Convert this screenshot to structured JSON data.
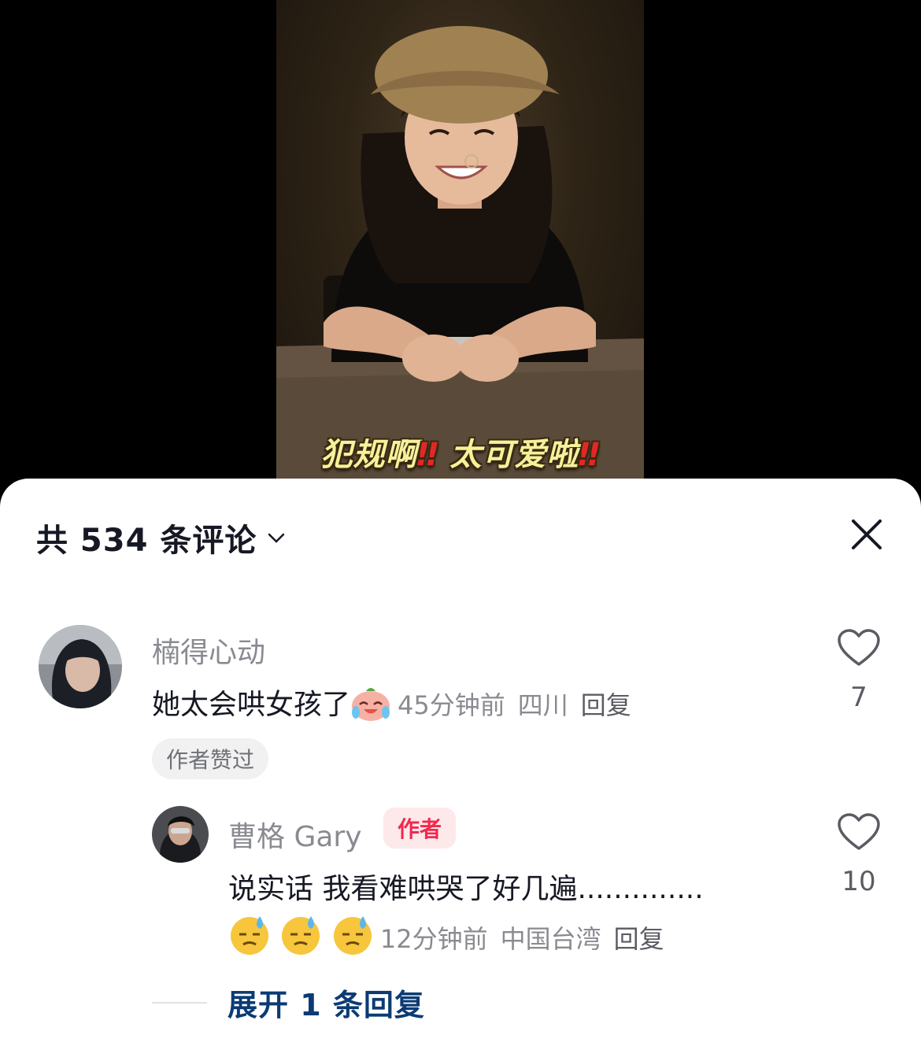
{
  "video": {
    "subtitle_part1": "犯规啊",
    "subtitle_bang1": "‼",
    "subtitle_part2": "太可爱啦",
    "subtitle_bang2": "‼"
  },
  "comments_panel": {
    "title": "共 534 条评论",
    "close_icon": "close-icon",
    "expand_icon": "chevron-down-icon"
  },
  "comments": [
    {
      "username": "楠得心动",
      "text": "她太会哄女孩了",
      "emoji": "crying-laughing-emoji",
      "time": "45分钟前",
      "location": "四川",
      "reply_label": "回复",
      "likes": "7",
      "liked_by_author_label": "作者赞过"
    }
  ],
  "reply": {
    "username": "曹格 Gary",
    "author_badge": "作者",
    "text_line1": "说实话 我看难哄哭了好几遍..............",
    "emojis": [
      "sweat-emoji",
      "sweat-emoji",
      "sweat-emoji"
    ],
    "time": "12分钟前",
    "location": "中国台湾",
    "reply_label": "回复",
    "likes": "10"
  },
  "expand_replies": {
    "label": "展开 1 条回复"
  },
  "colors": {
    "accent_red": "#f2294d",
    "link_blue": "#0b3b74",
    "subtitle_yellow": "#f6f19a"
  }
}
